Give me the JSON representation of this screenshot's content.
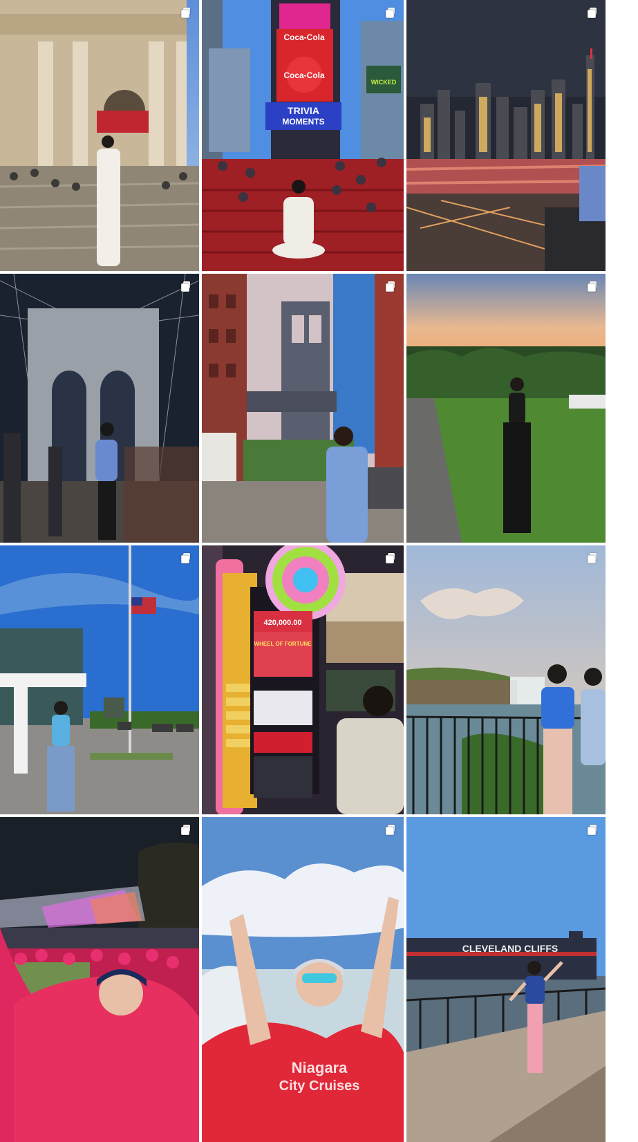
{
  "grid": {
    "posts": [
      {
        "id": 1,
        "label": "Met Museum steps",
        "multi": true
      },
      {
        "id": 2,
        "label": "Times Square red steps",
        "multi": true,
        "signs": [
          "Coca-Cola",
          "Coca-Cola",
          "TRIVIA",
          "MOMENTS",
          "WICKED"
        ]
      },
      {
        "id": 3,
        "label": "Manhattan skyline at night",
        "multi": true
      },
      {
        "id": 4,
        "label": "Brooklyn Bridge at night",
        "multi": true
      },
      {
        "id": 5,
        "label": "DUMBO Manhattan Bridge view",
        "multi": true
      },
      {
        "id": 6,
        "label": "Park at sunset",
        "multi": true
      },
      {
        "id": 7,
        "label": "Flagpole plaza",
        "multi": true
      },
      {
        "id": 8,
        "label": "Casino slot machine",
        "multi": true,
        "signs": [
          "420,000.00",
          "WHEEL OF FORTUNE"
        ]
      },
      {
        "id": 9,
        "label": "Niagara Falls lookout",
        "multi": true
      },
      {
        "id": 10,
        "label": "Illuminated falls at night",
        "multi": true
      },
      {
        "id": 11,
        "label": "Niagara City Cruises poncho",
        "multi": true,
        "signs": [
          "Niagara",
          "City Cruises"
        ]
      },
      {
        "id": 12,
        "label": "Cleveland ship waterfront",
        "multi": true,
        "signs": [
          "CLEVELAND CLIFFS"
        ]
      }
    ]
  },
  "colors": {
    "gap": "#ffffff",
    "badge": "#ffffff"
  }
}
